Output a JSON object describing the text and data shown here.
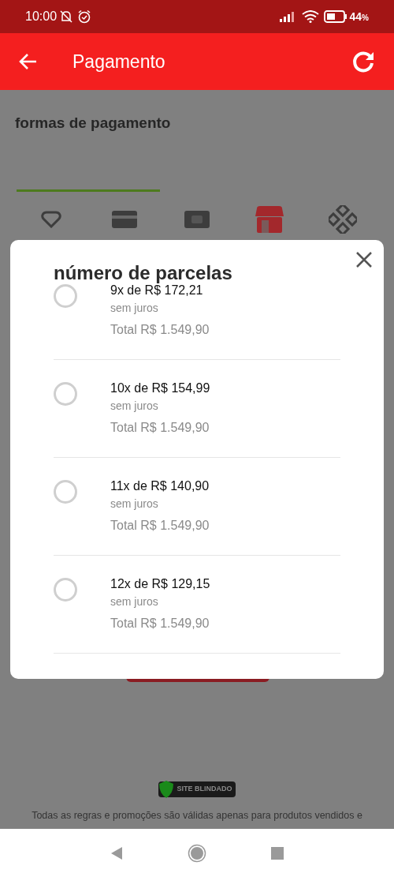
{
  "status_bar": {
    "time": "10:00",
    "battery": "44",
    "battery_unit": "%"
  },
  "header": {
    "title": "Pagamento"
  },
  "background": {
    "section_title": "formas de pagamento",
    "methods": [
      {
        "kind": "heart",
        "selected": false
      },
      {
        "kind": "card",
        "selected": false
      },
      {
        "kind": "cash",
        "selected": false
      },
      {
        "kind": "store",
        "selected": true
      },
      {
        "kind": "diamond",
        "selected": false
      }
    ],
    "badge": "SITE BLINDADO",
    "disclaimer": "Todas as regras e promoções são válidas apenas para produtos vendidos e"
  },
  "dialog": {
    "title": "número de parcelas",
    "options": [
      {
        "installment": "9x de R$ 172,21",
        "note": "sem juros",
        "total": "Total R$ 1.549,90",
        "selected": false
      },
      {
        "installment": "10x de R$ 154,99",
        "note": "sem juros",
        "total": "Total R$ 1.549,90",
        "selected": false
      },
      {
        "installment": "11x de R$ 140,90",
        "note": "sem juros",
        "total": "Total R$ 1.549,90",
        "selected": false
      },
      {
        "installment": "12x de R$ 129,15",
        "note": "sem juros",
        "total": "Total R$ 1.549,90",
        "selected": false
      }
    ]
  }
}
